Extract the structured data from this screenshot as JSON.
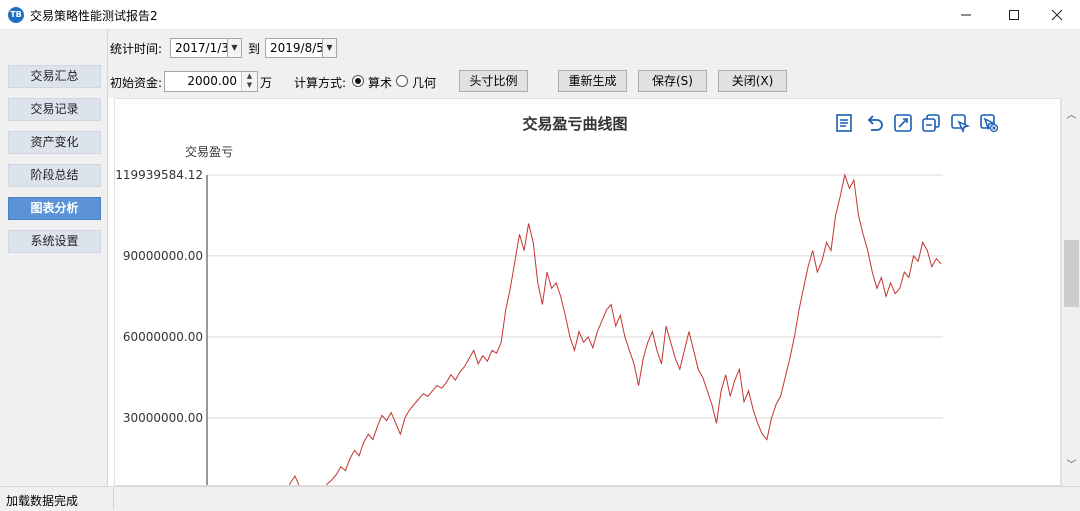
{
  "window": {
    "title": "交易策略性能测试报告2",
    "icon_text": "TB",
    "buttons": [
      "minimize-icon",
      "maximize-icon",
      "close-icon"
    ]
  },
  "sidebar": {
    "items": [
      {
        "label": "交易汇总",
        "active": false
      },
      {
        "label": "交易记录",
        "active": false
      },
      {
        "label": "资产变化",
        "active": false
      },
      {
        "label": "阶段总结",
        "active": false
      },
      {
        "label": "图表分析",
        "active": true
      },
      {
        "label": "系统设置",
        "active": false
      }
    ]
  },
  "toolbar": {
    "period_label": "统计时间:",
    "start_date": "2017/1/3",
    "to_label": "到",
    "end_date": "2019/8/5",
    "capital_label": "初始资金:",
    "capital_value": "2000.00",
    "capital_unit": "万",
    "calc_label": "计算方式:",
    "calc_options": [
      {
        "label": "算术",
        "selected": true
      },
      {
        "label": "几何",
        "selected": false
      }
    ],
    "buttons": {
      "ratio": "头寸比例",
      "regenerate": "重新生成",
      "save": "保存(S)",
      "close": "关闭(X)"
    }
  },
  "chart": {
    "toolbar_icons": [
      "data-view-icon",
      "restore-icon",
      "zoom-icon",
      "magic-type-icon",
      "select-zoom-icon",
      "zoom-reset-icon"
    ],
    "line_color": "#c23531"
  },
  "chart_data": {
    "type": "line",
    "title": "交易盈亏曲线图",
    "ylabel": "交易盈亏",
    "xlabel": "",
    "yticks": [
      "119939584.12",
      "90000000.00",
      "60000000.00",
      "30000000.00"
    ],
    "ytick_values": [
      119939584.12,
      90000000,
      60000000,
      30000000
    ],
    "ylim": [
      0,
      119939584.12
    ],
    "grid": true,
    "series": [
      {
        "values": [
          0,
          1200000,
          2500000,
          1800000,
          3500000,
          2000000,
          4200000,
          2800000,
          5000000,
          3200000,
          1800000,
          6000000,
          8500000,
          4500000,
          2000000,
          1000000,
          1500000,
          3000000,
          2200000,
          5500000,
          7000000,
          9000000,
          12000000,
          10500000,
          15000000,
          18000000,
          16000000,
          21000000,
          24000000,
          22000000,
          27000000,
          31000000,
          29000000,
          32000000,
          28000000,
          24000000,
          30000000,
          33000000,
          35000000,
          37000000,
          39000000,
          38000000,
          40000000,
          42000000,
          41000000,
          43000000,
          46000000,
          44000000,
          47000000,
          49000000,
          52000000,
          55000000,
          50000000,
          53000000,
          51000000,
          55000000,
          54000000,
          58000000,
          70000000,
          78000000,
          88000000,
          98000000,
          92000000,
          102000000,
          95000000,
          80000000,
          72000000,
          84000000,
          78000000,
          80000000,
          75000000,
          68000000,
          60000000,
          55000000,
          62000000,
          58000000,
          60000000,
          56000000,
          62000000,
          66000000,
          70000000,
          72000000,
          64000000,
          68000000,
          60000000,
          55000000,
          50000000,
          42000000,
          52000000,
          58000000,
          62000000,
          55000000,
          50000000,
          64000000,
          58000000,
          52000000,
          48000000,
          55000000,
          62000000,
          55000000,
          48000000,
          45000000,
          40000000,
          35000000,
          28000000,
          40000000,
          46000000,
          38000000,
          44000000,
          48000000,
          36000000,
          40000000,
          33000000,
          28000000,
          24000000,
          22000000,
          30000000,
          35000000,
          38000000,
          45000000,
          52000000,
          60000000,
          70000000,
          78000000,
          86000000,
          92000000,
          84000000,
          88000000,
          95000000,
          92000000,
          105000000,
          112000000,
          119939584.12,
          115000000,
          118000000,
          105000000,
          98000000,
          92000000,
          84000000,
          78000000,
          82000000,
          75000000,
          80000000,
          76000000,
          78000000,
          84000000,
          82000000,
          90000000,
          88000000,
          95000000,
          92000000,
          86000000,
          89000000,
          87000000
        ]
      }
    ]
  },
  "status": {
    "text": "加载数据完成"
  }
}
